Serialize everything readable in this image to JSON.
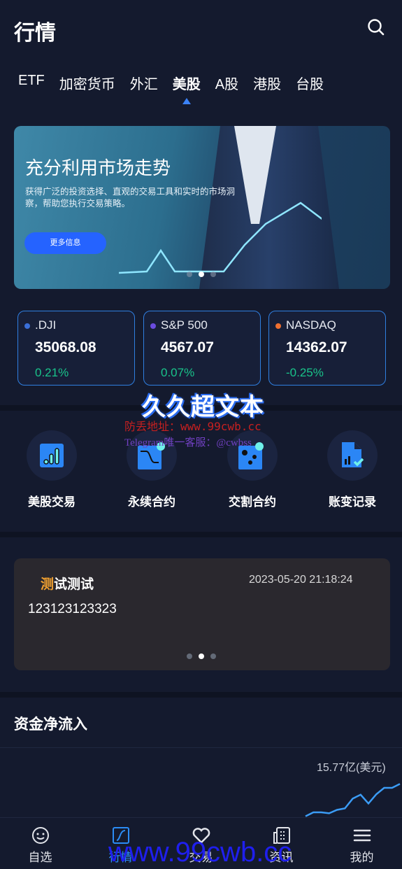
{
  "header": {
    "title": "行情",
    "search_icon": "search-icon"
  },
  "tabs": [
    {
      "label": "ETF"
    },
    {
      "label": "加密货币"
    },
    {
      "label": "外汇"
    },
    {
      "label": "美股",
      "active": true
    },
    {
      "label": "A股"
    },
    {
      "label": "港股"
    },
    {
      "label": "台股"
    }
  ],
  "banner": {
    "heading": "充分利用市场走势",
    "text": "获得广泛的投资选择、直观的交易工具和实时的市场洞察，帮助您执行交易策略。",
    "button": "更多信息",
    "active_slide": 2,
    "slides": 3
  },
  "indices": [
    {
      "name": ".DJI",
      "price": "35068.08",
      "change": "0.21%",
      "dot": "#3a6fd8"
    },
    {
      "name": "S&P 500",
      "price": "4567.07",
      "change": "0.07%",
      "dot": "#6a4ce0"
    },
    {
      "name": "NASDAQ",
      "price": "14362.07",
      "change": "-0.25%",
      "dot": "#f07030"
    }
  ],
  "menu": [
    {
      "label": "美股交易",
      "icon": "bar-chart-icon"
    },
    {
      "label": "永续合约",
      "icon": "curve-chart-icon"
    },
    {
      "label": "交割合约",
      "icon": "dots-box-icon"
    },
    {
      "label": "账变记录",
      "icon": "document-check-icon"
    }
  ],
  "notice": {
    "title_highlight": "测",
    "title_rest": "试测试",
    "date": "2023-05-20 21:18:24",
    "body": "123123123323",
    "active_slide": 2,
    "slides": 3
  },
  "flow": {
    "title": "资金净流入",
    "value": "15.77亿(美元)"
  },
  "chart_data": {
    "type": "line",
    "series": [
      {
        "values": [
          0.2,
          1.0,
          1.0,
          0.8,
          1.5,
          1.8,
          3.8,
          4.6,
          2.8,
          4.7,
          6.0,
          6.0,
          6.8
        ]
      }
    ]
  },
  "nav": [
    {
      "label": "自选",
      "icon": "smiley-icon"
    },
    {
      "label": "行情",
      "icon": "market-icon",
      "active": true
    },
    {
      "label": "交易",
      "icon": "handshake-icon"
    },
    {
      "label": "资讯",
      "icon": "news-icon"
    },
    {
      "label": "我的",
      "icon": "menu-icon"
    }
  ],
  "watermark": {
    "title": "久久超文本",
    "line1": "防丢地址：www.99cwb.cc",
    "line2": "Telegram唯一客服：@cwbss",
    "url": "www.99cwb.cc"
  },
  "colors": {
    "accent": "#2563ff",
    "up": "#19c38a",
    "bg": "#141a2e"
  }
}
